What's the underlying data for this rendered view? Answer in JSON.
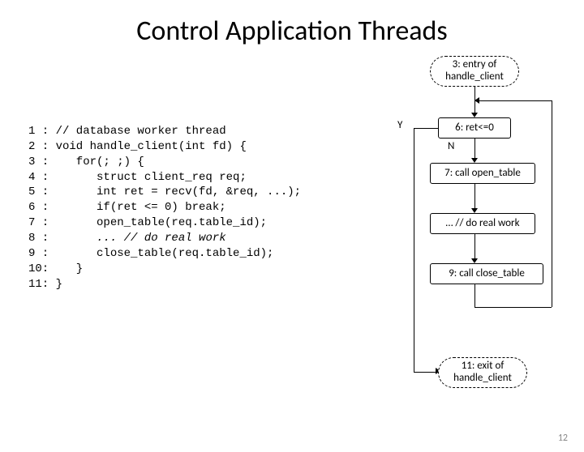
{
  "title": "Control Application Threads",
  "code": {
    "l1": "1 : // database worker thread",
    "l2": "2 : void handle_client(int fd) {",
    "l3": "3 :    for(; ;) {",
    "l4": "4 :       struct client_req req;",
    "l5": "5 :       int ret = recv(fd, &req, ...);",
    "l6": "6 :       if(ret <= 0) break;",
    "l7": "7 :       open_table(req.table_id);",
    "l8a": "8 :       ",
    "l8b": "... // do real work",
    "l9": "9 :       close_table(req.table_id);",
    "l10": "10:    }",
    "l11": "11: }"
  },
  "flow": {
    "entry": "3: entry of\nhandle_client",
    "ret": "6: ret<=0",
    "open": "7: call open_table",
    "work": "… // do real work",
    "close": "9: call close_table",
    "exit": "11: exit of\nhandle_client",
    "Y": "Y",
    "N": "N"
  },
  "page": "12"
}
